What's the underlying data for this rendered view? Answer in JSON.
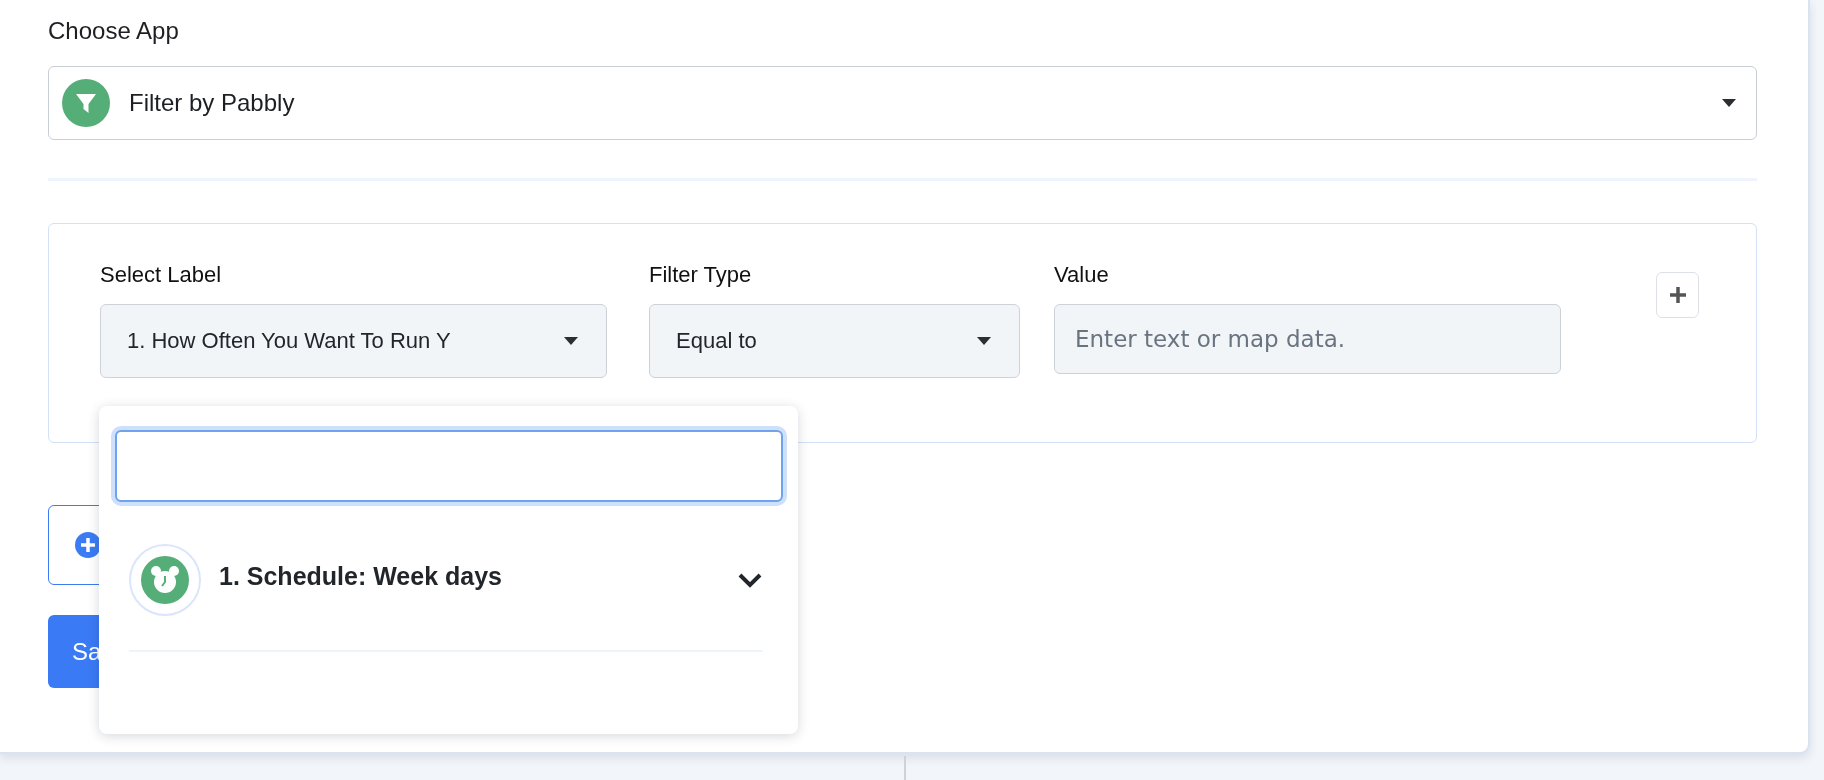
{
  "choose_app": {
    "label": "Choose App",
    "value": "Filter by Pabbly"
  },
  "filter": {
    "columns": [
      {
        "kind": "select",
        "label": "Select Label",
        "value": "1. How Often You Want To Run Y"
      },
      {
        "kind": "select",
        "label": "Filter Type",
        "value": "Equal to"
      },
      {
        "kind": "input",
        "label": "Value",
        "placeholder": "Enter text or map data."
      }
    ]
  },
  "dropdown": {
    "search": {
      "focused": true
    },
    "options": [
      {
        "label": "1. Schedule: Week days",
        "expanded": false
      }
    ]
  },
  "buttons": [
    {
      "kind": "add"
    },
    {
      "kind": "save",
      "label": "Sa"
    }
  ]
}
